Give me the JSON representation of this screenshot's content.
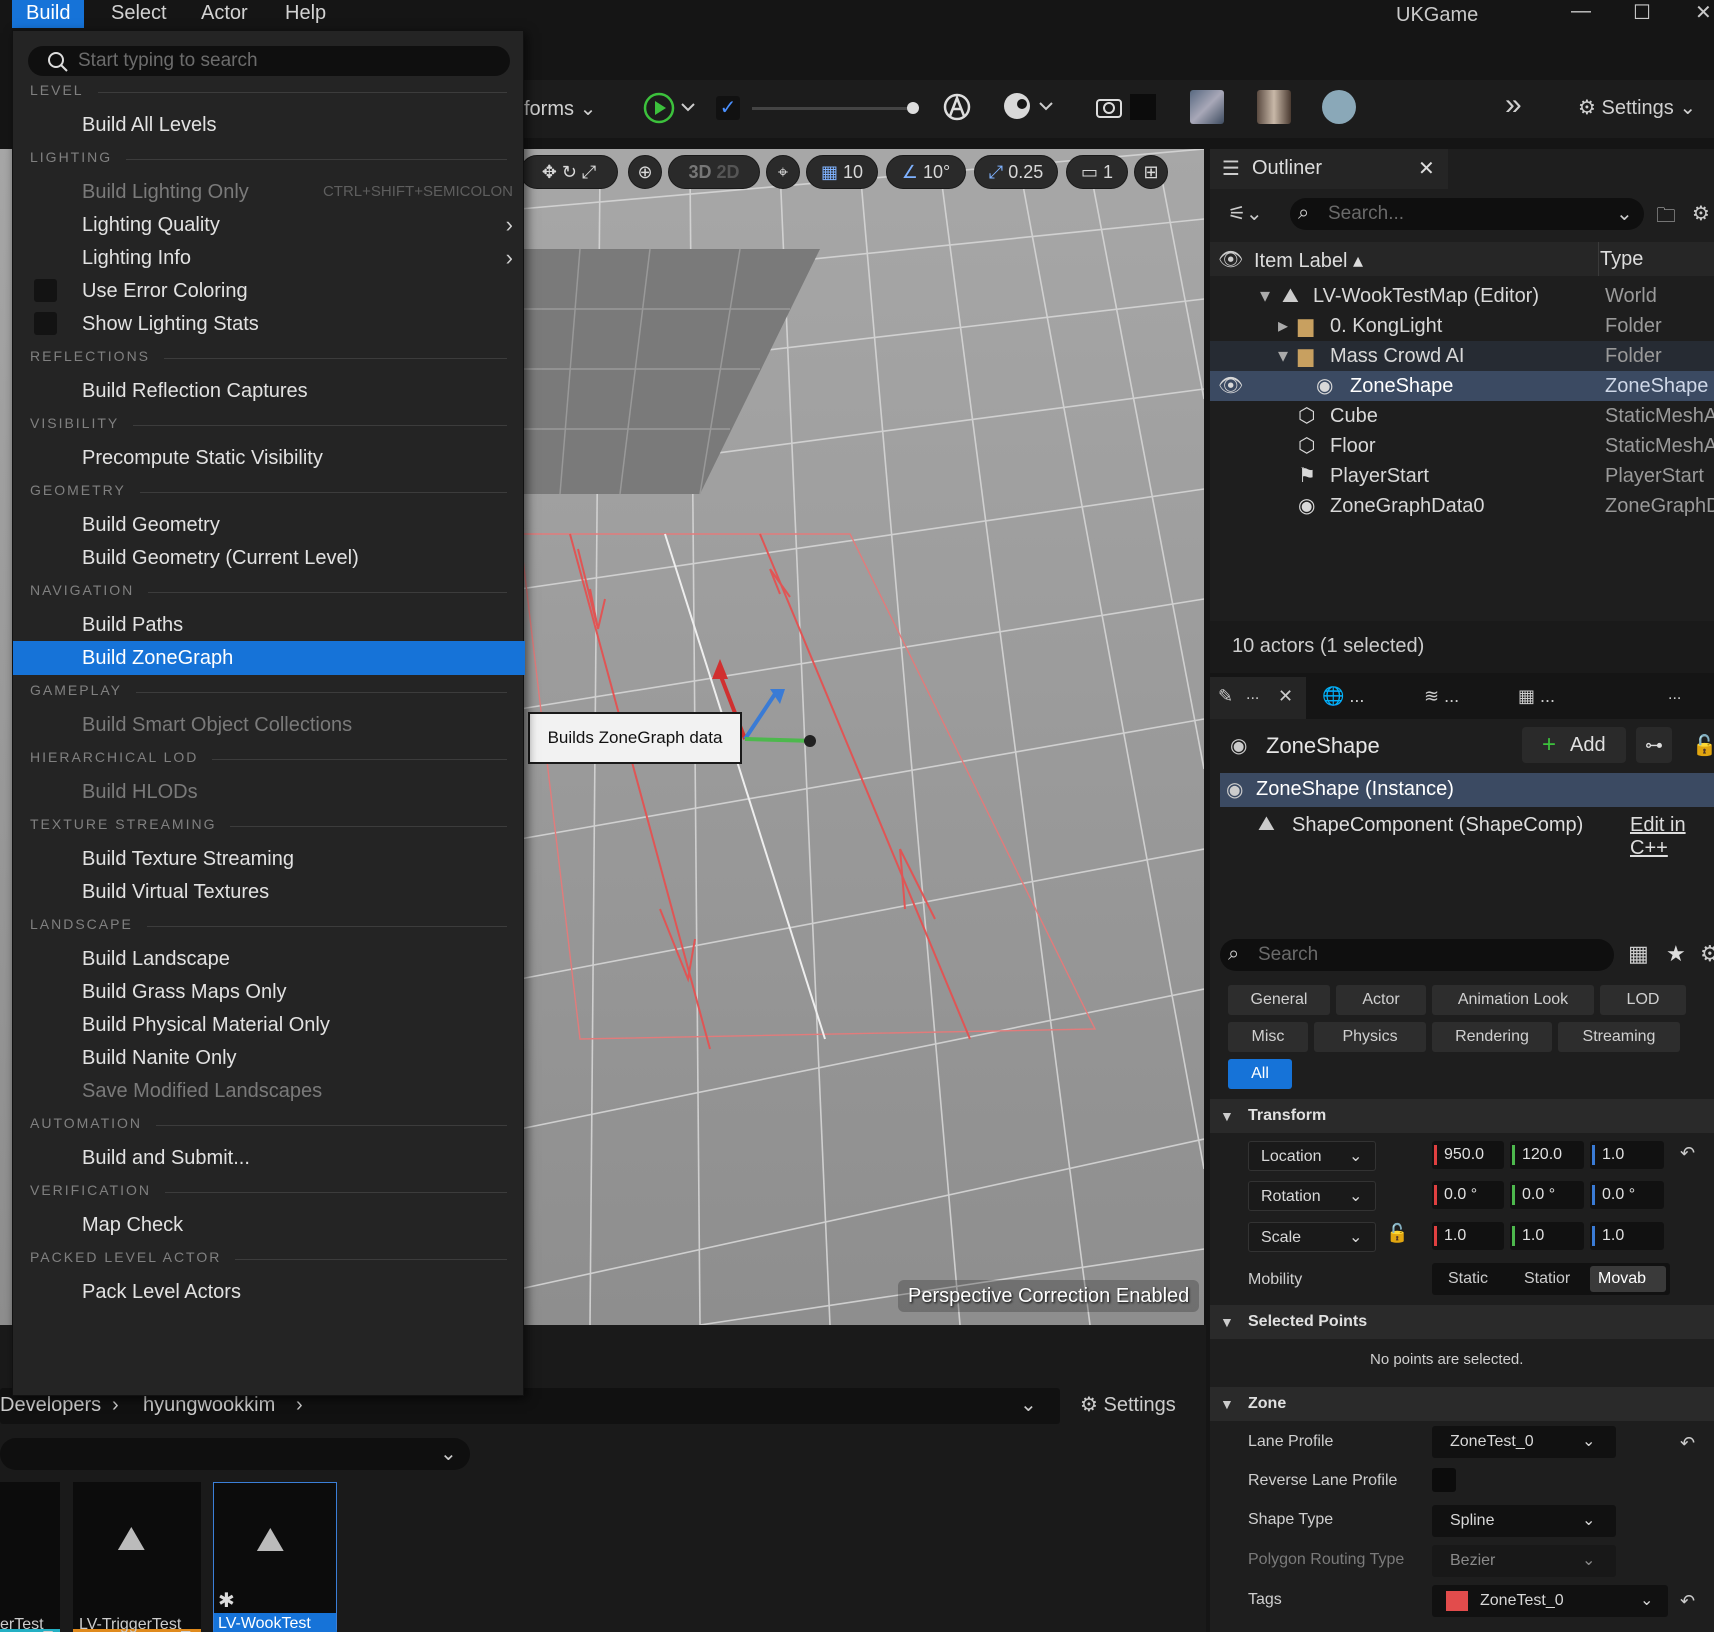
{
  "menubar": {
    "items": [
      "Build",
      "Select",
      "Actor",
      "Help"
    ],
    "window_title": "UKGame"
  },
  "toolbar": {
    "transforms_label": "forms",
    "settings_label": "Settings"
  },
  "viewport": {
    "grid_value": "10",
    "angle_value": "10°",
    "scale_value": "0.25",
    "camera_speed": "1",
    "mode_3d": "3D",
    "mode_2d": "2D",
    "perspective_label": "Perspective Correction",
    "perspective_state": "Enabled",
    "tooltip": "Builds ZoneGraph data"
  },
  "build_menu": {
    "search_placeholder": "Start typing to search",
    "sections": [
      {
        "title": "LEVEL",
        "items": [
          {
            "label": "Build All Levels"
          }
        ]
      },
      {
        "title": "LIGHTING",
        "items": [
          {
            "label": "Build Lighting Only",
            "shortcut": "CTRL+SHIFT+SEMICOLON",
            "disabled": true
          },
          {
            "label": "Lighting Quality",
            "submenu": true
          },
          {
            "label": "Lighting Info",
            "submenu": true
          },
          {
            "label": "Use Error Coloring",
            "checkbox": true
          },
          {
            "label": "Show Lighting Stats",
            "checkbox": true
          }
        ]
      },
      {
        "title": "REFLECTIONS",
        "items": [
          {
            "label": "Build Reflection Captures"
          }
        ]
      },
      {
        "title": "VISIBILITY",
        "items": [
          {
            "label": "Precompute Static Visibility"
          }
        ]
      },
      {
        "title": "GEOMETRY",
        "items": [
          {
            "label": "Build Geometry"
          },
          {
            "label": "Build Geometry (Current Level)"
          }
        ]
      },
      {
        "title": "NAVIGATION",
        "items": [
          {
            "label": "Build Paths"
          },
          {
            "label": "Build ZoneGraph",
            "highlighted": true
          }
        ]
      },
      {
        "title": "GAMEPLAY",
        "items": [
          {
            "label": "Build Smart Object Collections",
            "disabled": true
          }
        ]
      },
      {
        "title": "HIERARCHICAL LOD",
        "items": [
          {
            "label": "Build HLODs",
            "disabled": true
          }
        ]
      },
      {
        "title": "TEXTURE STREAMING",
        "items": [
          {
            "label": "Build Texture Streaming"
          },
          {
            "label": "Build Virtual Textures"
          }
        ]
      },
      {
        "title": "LANDSCAPE",
        "items": [
          {
            "label": "Build Landscape"
          },
          {
            "label": "Build Grass Maps Only"
          },
          {
            "label": "Build Physical Material Only"
          },
          {
            "label": "Build Nanite Only"
          },
          {
            "label": "Save Modified Landscapes",
            "disabled": true
          }
        ]
      },
      {
        "title": "AUTOMATION",
        "items": [
          {
            "label": "Build and Submit..."
          }
        ]
      },
      {
        "title": "VERIFICATION",
        "items": [
          {
            "label": "Map Check"
          }
        ]
      },
      {
        "title": "PACKED LEVEL ACTOR",
        "items": [
          {
            "label": "Pack Level Actors"
          }
        ]
      }
    ]
  },
  "content_browser": {
    "breadcrumb": [
      "Developers",
      "hyungwookkim"
    ],
    "settings_label": "Settings",
    "assets": [
      {
        "label": "erTest_"
      },
      {
        "label": "LV-TriggerTest_"
      },
      {
        "label": "LV-WookTest"
      }
    ]
  },
  "outliner": {
    "tab_title": "Outliner",
    "search_placeholder": "Search...",
    "col_label": "Item Label",
    "col_type": "Type",
    "rows": [
      {
        "label": "LV-WookTestMap (Editor)",
        "type": "World",
        "icon": "level-icon"
      },
      {
        "label": "0. KongLight",
        "type": "Folder",
        "icon": "folder-icon"
      },
      {
        "label": "Mass Crowd AI",
        "type": "Folder",
        "icon": "folder-icon"
      },
      {
        "label": "ZoneShape",
        "type": "ZoneShape",
        "icon": "actor-icon"
      },
      {
        "label": "Cube",
        "type": "StaticMeshA",
        "icon": "mesh-icon"
      },
      {
        "label": "Floor",
        "type": "StaticMeshA",
        "icon": "mesh-icon"
      },
      {
        "label": "PlayerStart",
        "type": "PlayerStart",
        "icon": "playerstart-icon"
      },
      {
        "label": "ZoneGraphData0",
        "type": "ZoneGraphD",
        "icon": "actor-icon"
      }
    ],
    "status": "10 actors (1 selected)"
  },
  "details": {
    "tab_dots": [
      "...",
      "...",
      "...",
      "...",
      "..."
    ],
    "actor_name": "ZoneShape",
    "add_label": "Add",
    "instance_label": "ZoneShape (Instance)",
    "component_label": "ShapeComponent (ShapeComp)",
    "edit_label": "Edit in C++",
    "search_placeholder": "Search",
    "filters_row1": [
      "General",
      "Actor",
      "Animation Look",
      "LOD"
    ],
    "filters_row2": [
      "Misc",
      "Physics",
      "Rendering",
      "Streaming"
    ],
    "filter_all": "All",
    "transform_title": "Transform",
    "location_label": "Location",
    "location": [
      "950.0",
      "120.0",
      "1.0"
    ],
    "rotation_label": "Rotation",
    "rotation": [
      "0.0 °",
      "0.0 °",
      "0.0 °"
    ],
    "scale_label": "Scale",
    "scale": [
      "1.0",
      "1.0",
      "1.0"
    ],
    "mobility_label": "Mobility",
    "mobility_options": [
      "Static",
      "Statior",
      "Movab"
    ],
    "selected_points_title": "Selected Points",
    "no_points": "No points are selected.",
    "zone_title": "Zone",
    "lane_profile_label": "Lane Profile",
    "lane_profile_value": "ZoneTest_0",
    "reverse_label": "Reverse Lane Profile",
    "shape_type_label": "Shape Type",
    "shape_type_value": "Spline",
    "polygon_label": "Polygon Routing Type",
    "polygon_value": "Bezier",
    "tags_label": "Tags",
    "tags_value": "ZoneTest_0",
    "tag_color": "#e24c4c"
  },
  "colors": {
    "accent": "#1673d8",
    "x_axis": "#e04040",
    "y_axis": "#4db84d",
    "z_axis": "#3a7bd5"
  }
}
